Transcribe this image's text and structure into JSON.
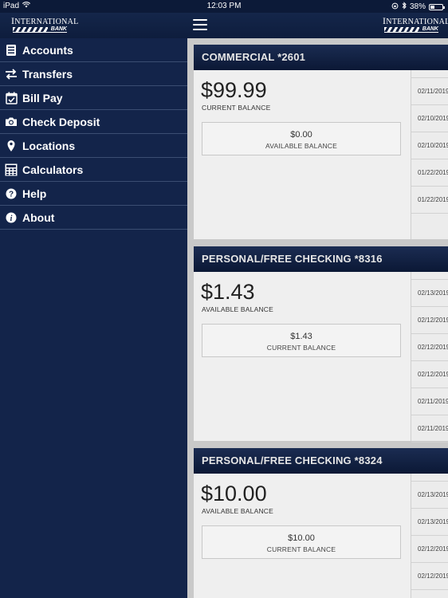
{
  "status": {
    "device": "iPad",
    "time": "12:03 PM",
    "battery": "38%",
    "battery_level": 0.38
  },
  "header": {
    "logo_word_cap": "I",
    "logo_word_rest": "NTERNATIONAL",
    "logo_bank": "BANK"
  },
  "sidebar": {
    "items": [
      {
        "label": "Accounts",
        "icon": "accounts-icon"
      },
      {
        "label": "Transfers",
        "icon": "transfers-icon"
      },
      {
        "label": "Bill Pay",
        "icon": "calendar-check-icon"
      },
      {
        "label": "Check Deposit",
        "icon": "camera-icon"
      },
      {
        "label": "Locations",
        "icon": "map-pin-icon"
      },
      {
        "label": "Calculators",
        "icon": "calculator-icon"
      },
      {
        "label": "Help",
        "icon": "help-icon"
      },
      {
        "label": "About",
        "icon": "info-icon"
      }
    ]
  },
  "accounts": [
    {
      "title": "COMMERCIAL *2601",
      "amount": "$99.99",
      "amount_label": "CURRENT BALANCE",
      "sub_amount": "$0.00",
      "sub_label": "AVAILABLE BALANCE",
      "dates": [
        "02/11/2019",
        "02/10/2019",
        "02/10/2019",
        "01/22/2019",
        "01/22/2019"
      ]
    },
    {
      "title": "PERSONAL/FREE CHECKING *8316",
      "amount": "$1.43",
      "amount_label": "AVAILABLE BALANCE",
      "sub_amount": "$1.43",
      "sub_label": "CURRENT BALANCE",
      "dates": [
        "02/13/2019",
        "02/12/2019",
        "02/12/2019",
        "02/12/2019",
        "02/11/2019",
        "02/11/2019"
      ]
    },
    {
      "title": "PERSONAL/FREE CHECKING *8324",
      "amount": "$10.00",
      "amount_label": "AVAILABLE BALANCE",
      "sub_amount": "$10.00",
      "sub_label": "CURRENT BALANCE",
      "dates": [
        "02/13/2019",
        "02/13/2019",
        "02/12/2019",
        "02/12/2019"
      ]
    }
  ]
}
